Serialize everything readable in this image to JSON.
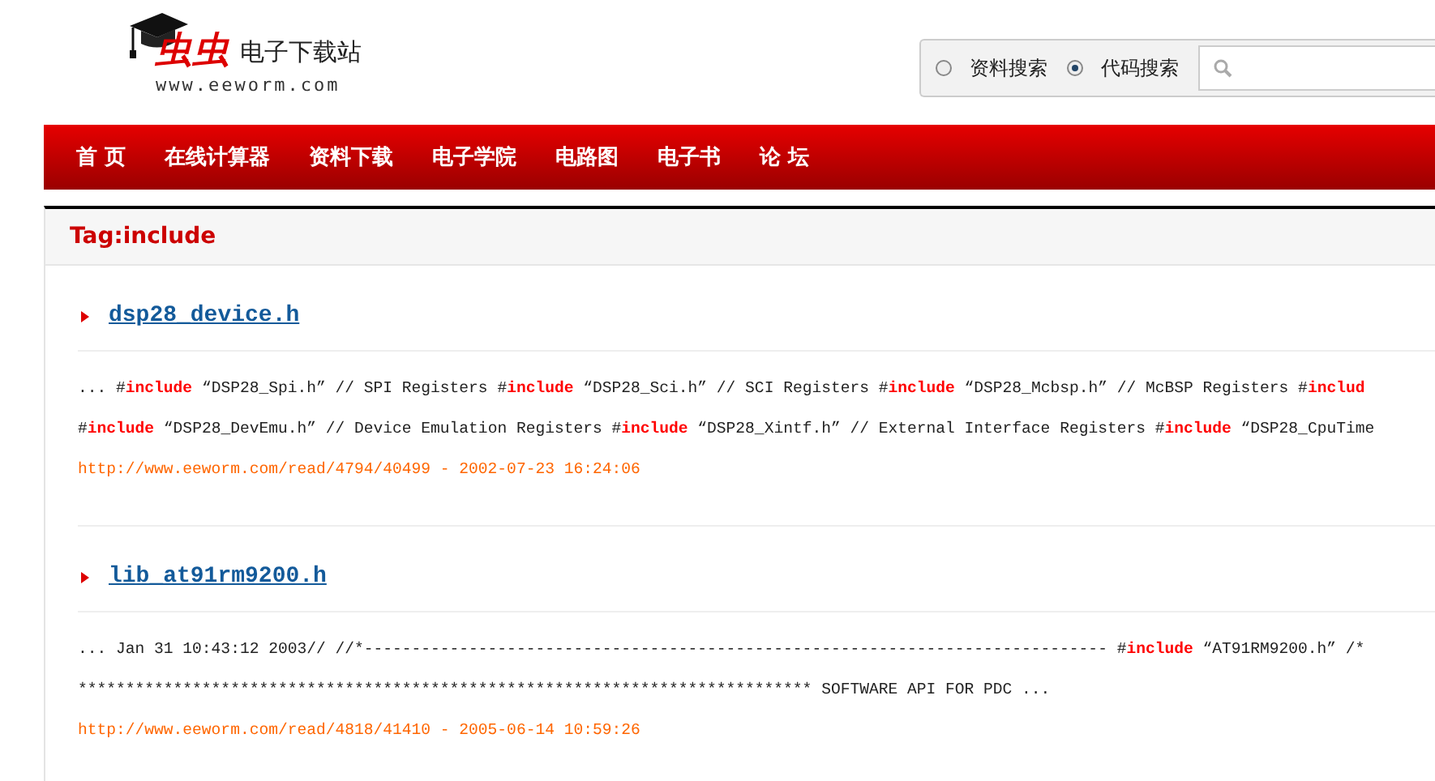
{
  "logo": {
    "brand": "虫虫",
    "site_name": "电子下载站",
    "domain": "www.eeworm.com"
  },
  "search": {
    "options": [
      {
        "label": "资料搜索",
        "selected": false
      },
      {
        "label": "代码搜索",
        "selected": true
      }
    ]
  },
  "nav": {
    "items": [
      {
        "label": "首 页"
      },
      {
        "label": "在线计算器"
      },
      {
        "label": "资料下载"
      },
      {
        "label": "电子学院"
      },
      {
        "label": "电路图"
      },
      {
        "label": "电子书"
      },
      {
        "label": "论 坛"
      }
    ]
  },
  "panel": {
    "title": "Tag:include"
  },
  "results": [
    {
      "title": "dsp28_device.h",
      "lines": [
        [
          {
            "kind": "plain",
            "text": "... #"
          },
          {
            "kind": "keyword",
            "text": "include"
          },
          {
            "kind": "plain",
            "text": " “DSP28_Spi.h” // SPI Registers #"
          },
          {
            "kind": "keyword",
            "text": "include"
          },
          {
            "kind": "plain",
            "text": " “DSP28_Sci.h” // SCI Registers #"
          },
          {
            "kind": "keyword",
            "text": "include"
          },
          {
            "kind": "plain",
            "text": " “DSP28_Mcbsp.h” // McBSP Registers #"
          },
          {
            "kind": "keyword",
            "text": "includ"
          }
        ],
        [
          {
            "kind": "plain",
            "text": "#"
          },
          {
            "kind": "keyword",
            "text": "include"
          },
          {
            "kind": "plain",
            "text": " “DSP28_DevEmu.h” // Device Emulation Registers #"
          },
          {
            "kind": "keyword",
            "text": "include"
          },
          {
            "kind": "plain",
            "text": " “DSP28_Xintf.h” // External Interface Registers #"
          },
          {
            "kind": "keyword",
            "text": "include"
          },
          {
            "kind": "plain",
            "text": " “DSP28_CpuTime"
          }
        ]
      ],
      "url": "http://www.eeworm.com/read/4794/40499 - 2002-07-23 16:24:06"
    },
    {
      "title": "lib_at91rm9200.h",
      "lines": [
        [
          {
            "kind": "plain",
            "text": "... Jan 31 10:43:12 2003// //*------------------------------------------------------------------------------ #"
          },
          {
            "kind": "keyword",
            "text": "include"
          },
          {
            "kind": "plain",
            "text": " “AT91RM9200.h” /*"
          }
        ],
        [
          {
            "kind": "plain",
            "text": "***************************************************************************** SOFTWARE API FOR PDC ..."
          }
        ]
      ],
      "url": "http://www.eeworm.com/read/4818/41410 - 2005-06-14 10:59:26"
    }
  ]
}
